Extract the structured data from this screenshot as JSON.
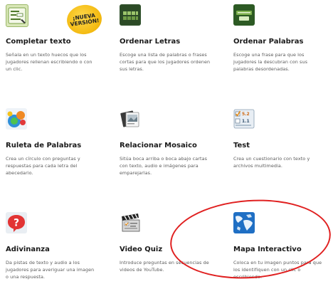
{
  "badge": {
    "line1": "¡NUEVA",
    "line2": "VERSIÓN!"
  },
  "activities": [
    {
      "title": "Completar texto",
      "description": "Señala en un texto huecos que los jugadores rellenan escribiendo o con un clic.",
      "icon": "fill-text-icon"
    },
    {
      "title": "Ordenar Letras",
      "description": "Escoge una lista de palabras o frases cortas para que los jugadores ordenen sus letras.",
      "icon": "letter-tiles-icon"
    },
    {
      "title": "Ordenar Palabras",
      "description": "Escoge una frase para que los jugadores la descubran con sus palabras desordenadas.",
      "icon": "word-cards-icon"
    },
    {
      "title": "Ruleta de Palabras",
      "description": "Crea un círculo con preguntas y respuestas para cada letra del abecedario.",
      "icon": "letter-wheel-icon"
    },
    {
      "title": "Relacionar Mosaico",
      "description": "Sitúa boca arriba o boca abajo cartas con texto, audio e imágenes para emparejarlas.",
      "icon": "photo-cards-icon"
    },
    {
      "title": "Test",
      "description": "Crea un cuestionario con texto y archivos multimedia.",
      "icon": "test-checklist-icon"
    },
    {
      "title": "Adivinanza",
      "description": "Da pistas de texto y audio a los jugadores para averiguar una imagen o una respuesta.",
      "icon": "question-bubble-icon"
    },
    {
      "title": "Video Quiz",
      "description": "Introduce preguntas en secuencias de videos de YouTube.",
      "icon": "clapperboard-icon"
    },
    {
      "title": "Mapa Interactivo",
      "description": "Coloca en tu imagen puntos para que los identifiquen con un clic o escribiendo.",
      "icon": "world-map-icon"
    }
  ]
}
